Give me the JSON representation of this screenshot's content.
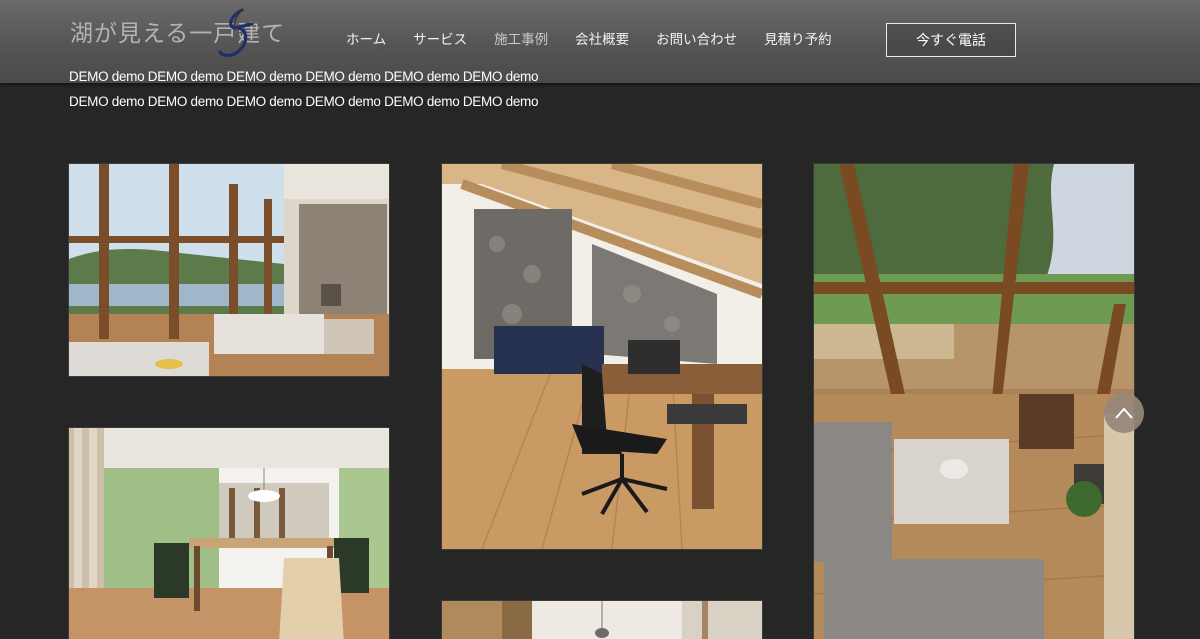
{
  "header": {
    "logo_text": "湖が見える一戸建て",
    "logo_mark_icon": "swirl-5-logo-icon",
    "nav": [
      {
        "label": "ホーム",
        "active": false
      },
      {
        "label": "サービス",
        "active": false
      },
      {
        "label": "施工事例",
        "active": true
      },
      {
        "label": "会社概要",
        "active": false
      },
      {
        "label": "お問い合わせ",
        "active": false
      },
      {
        "label": "見積り予約",
        "active": false
      }
    ],
    "call_button": "今すぐ電話"
  },
  "intro": {
    "line1": "DEMO demo DEMO demo DEMO demo DEMO demo DEMO demo DEMO demo",
    "line2": "DEMO demo DEMO demo DEMO demo DEMO demo DEMO demo DEMO demo"
  },
  "gallery": [
    {
      "name": "living-room-lake-view-photo"
    },
    {
      "name": "attic-office-desk-photo"
    },
    {
      "name": "sunroom-aerial-living-photo"
    },
    {
      "name": "dining-room-glass-walls-photo"
    },
    {
      "name": "interior-partial-photo"
    }
  ],
  "scroll_top_icon": "chevron-up-icon",
  "colors": {
    "background": "#262626",
    "header": "#555555",
    "scroll_button": "#968778"
  }
}
